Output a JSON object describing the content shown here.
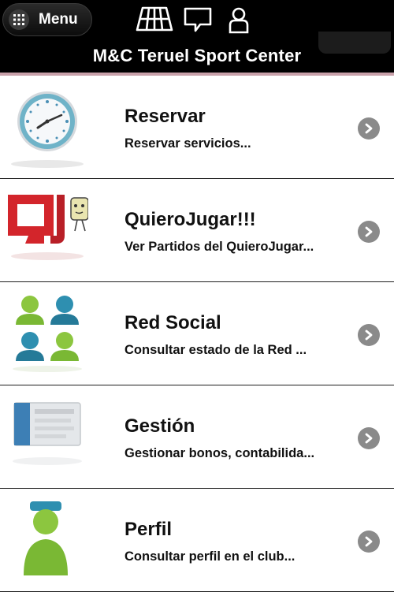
{
  "header": {
    "menu_label": "Menu",
    "title": "M&C Teruel Sport Center",
    "icons": [
      "court-icon",
      "chat-bubble-icon",
      "user-icon"
    ]
  },
  "items": [
    {
      "title": "Reservar",
      "subtitle": "Reservar servicios...",
      "icon": "clock-icon"
    },
    {
      "title": "QuieroJugar!!!",
      "subtitle": "Ver Partidos del QuieroJugar...",
      "icon": "quierojugar-logo-icon"
    },
    {
      "title": "Red Social",
      "subtitle": "Consultar estado de la Red ...",
      "icon": "social-network-users-icon"
    },
    {
      "title": "Gestión",
      "subtitle": "Gestionar bonos, contabilida...",
      "icon": "management-panel-icon"
    },
    {
      "title": "Perfil",
      "subtitle": "Consultar perfil en el club...",
      "icon": "profile-user-icon"
    }
  ],
  "colors": {
    "header_bg": "#000000",
    "accent_line": "#c9a1aa",
    "arrow_bg": "#8a8a8a"
  }
}
